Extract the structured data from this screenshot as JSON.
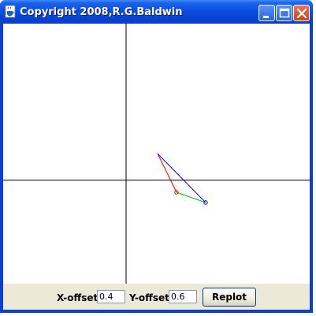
{
  "window": {
    "title": "Copyright 2008,R.G.Baldwin",
    "icons": {
      "app": "java-coffee-cup-icon",
      "minimize": "minimize-icon",
      "maximize": "maximize-icon",
      "close": "close-icon"
    }
  },
  "controls": {
    "x_offset_label": "X-offset",
    "x_offset_value": "0.4",
    "y_offset_label": "Y-offset",
    "y_offset_value": "0.6",
    "replot_label": "Replot"
  },
  "colors": {
    "title_bar": "#0a4fe0",
    "control_panel": "#ece9d8",
    "vector_red": "#ff0000",
    "vector_blue": "#0000ff",
    "vector_green": "#00c000"
  }
}
